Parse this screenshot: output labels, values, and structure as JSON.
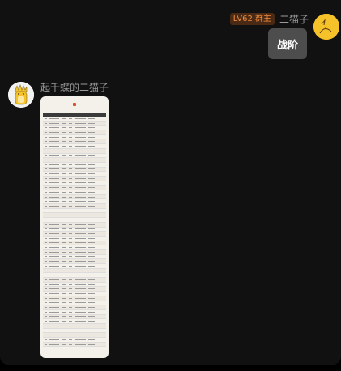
{
  "messages": {
    "outgoing": {
      "badge": "LV62 群主",
      "sender": "二猫子",
      "text": "战阶"
    },
    "incoming": {
      "sender": "起千蝶的二猫子",
      "image": {
        "title": "战阶",
        "rows": 50
      }
    }
  },
  "colors": {
    "badge_bg": "#4a2a14",
    "badge_text": "#f08c3c",
    "bubble": "#4d4d4d",
    "background": "#111111"
  }
}
